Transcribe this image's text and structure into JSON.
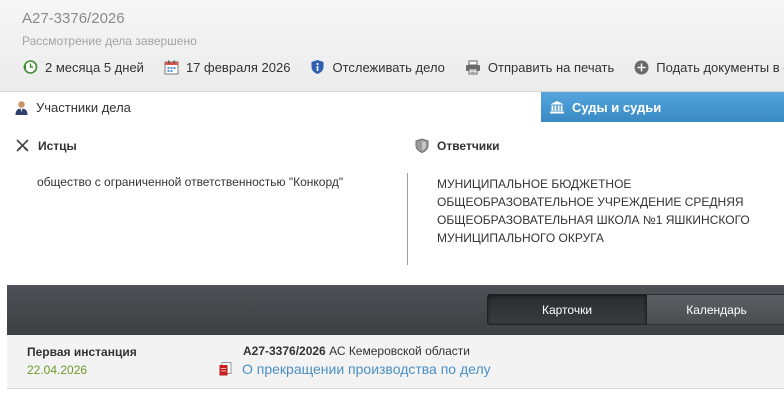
{
  "header": {
    "case_number": "А27-3376/2026",
    "status": "Рассмотрение дела завершено"
  },
  "toolbar": {
    "duration": "2 месяца 5 дней",
    "date": "17 февраля 2026",
    "track": "Отслеживать дело",
    "print": "Отправить на печать",
    "submit": "Подать документы в суд"
  },
  "tabs": {
    "participants": "Участники дела",
    "courts": "Суды и судьи"
  },
  "participants": {
    "plaintiffs_title": "Истцы",
    "plaintiff": "общество с ограниченной ответственностью \"Конкорд\"",
    "defendants_title": "Ответчики",
    "defendant": "МУНИЦИПАЛЬНОЕ БЮДЖЕТНОЕ ОБЩЕОБРАЗОВАТЕЛЬНОЕ УЧРЕЖДЕНИЕ СРЕДНЯЯ ОБЩЕОБРАЗОВАТЕЛЬНАЯ ШКОЛА №1 ЯШКИНСКОГО МУНИЦИПАЛЬНОГО ОКРУГА"
  },
  "view": {
    "cards": "Карточки",
    "calendar": "Календарь",
    "active": "cards"
  },
  "instance": {
    "label": "Первая инстанция",
    "date": "22.04.2026",
    "case_number": "А27-3376/2026",
    "court": "АС Кемеровской области",
    "document": "О прекращении производства по делу"
  },
  "colors": {
    "accent_blue": "#3a89c4",
    "link": "#4a8fc4",
    "date_green": "#6e9a2b"
  }
}
